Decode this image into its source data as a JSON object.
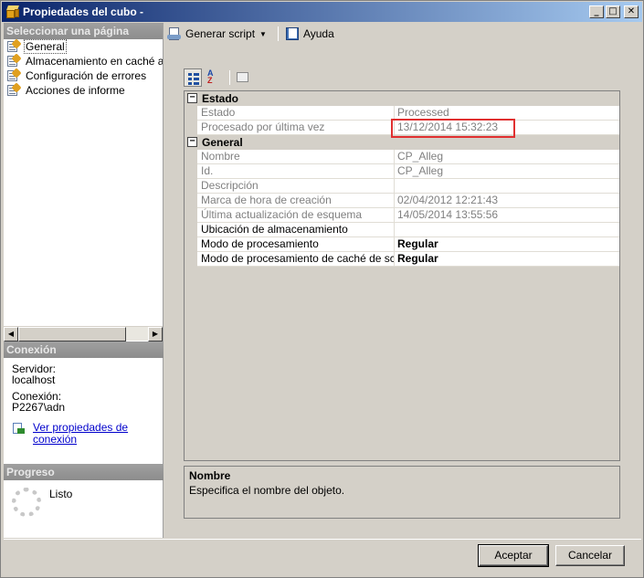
{
  "window": {
    "title": "Propiedades del cubo -",
    "controls": {
      "minimize": "_",
      "maximize": "□",
      "close": "✕"
    }
  },
  "left": {
    "select_page_header": "Seleccionar una página",
    "pages": [
      {
        "label": "General",
        "icon": "page-wrench-icon",
        "selected": true
      },
      {
        "label": "Almacenamiento en caché autc",
        "icon": "page-wrench-icon"
      },
      {
        "label": "Configuración de errores",
        "icon": "page-wrench-icon"
      },
      {
        "label": "Acciones de informe",
        "icon": "page-wrench-icon"
      }
    ],
    "connection": {
      "header": "Conexión",
      "server_label": "Servidor:",
      "server_value": "localhost",
      "connection_label": "Conexión:",
      "connection_value": "P2267\\adn",
      "link_line1": "Ver propiedades de",
      "link_line2": "conexión"
    },
    "progress": {
      "header": "Progreso",
      "status": "Listo"
    }
  },
  "toolbar": {
    "script_label": "Generar script",
    "help_label": "Ayuda"
  },
  "grid": {
    "categories": [
      {
        "name": "Estado",
        "toggle": "−",
        "rows": [
          {
            "name": "Estado",
            "value": "Processed",
            "readonly": true
          },
          {
            "name": "Procesado por última vez",
            "value": "13/12/2014 15:32:23",
            "readonly": true
          }
        ]
      },
      {
        "name": "General",
        "toggle": "−",
        "rows": [
          {
            "name": "Nombre",
            "value": "CP_Alleg",
            "readonly": true
          },
          {
            "name": "Id.",
            "value": "CP_Alleg",
            "readonly": true
          },
          {
            "name": "Descripción",
            "value": "",
            "readonly": true
          },
          {
            "name": "Marca de hora de creación",
            "value": "02/04/2012 12:21:43",
            "readonly": true
          },
          {
            "name": "Última actualización de esquema",
            "value": "14/05/2014 13:55:56",
            "readonly": true
          },
          {
            "name": "Ubicación de almacenamiento",
            "value": "",
            "readonly": false
          },
          {
            "name": "Modo de procesamiento",
            "value": "Regular",
            "readonly": false
          },
          {
            "name": "Modo de procesamiento de caché de script",
            "value": "Regular",
            "readonly": false
          }
        ]
      }
    ]
  },
  "description": {
    "title": "Nombre",
    "text": "Especifica el nombre del objeto."
  },
  "buttons": {
    "ok": "Aceptar",
    "cancel": "Cancelar"
  },
  "colors": {
    "title_gradient_start": "#0a246a",
    "title_gradient_end": "#a6caf0",
    "highlight_border": "#e03030"
  }
}
